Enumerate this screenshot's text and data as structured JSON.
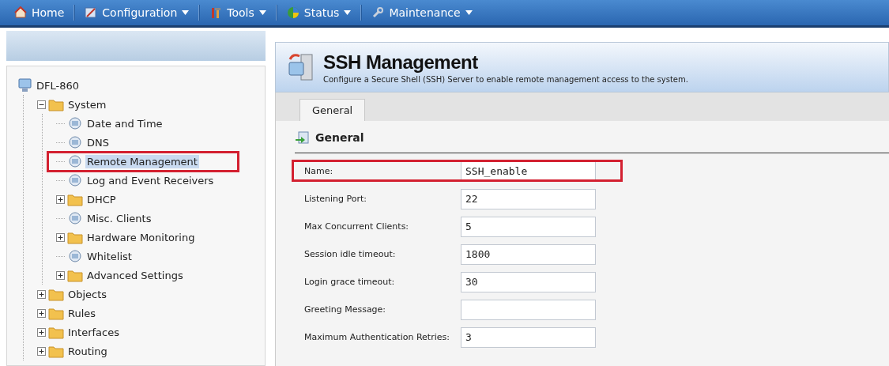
{
  "nav": [
    {
      "label": "Home",
      "dropdown": false
    },
    {
      "label": "Configuration",
      "dropdown": true
    },
    {
      "label": "Tools",
      "dropdown": true
    },
    {
      "label": "Status",
      "dropdown": true
    },
    {
      "label": "Maintenance",
      "dropdown": true
    }
  ],
  "tree": [
    {
      "label": "DFL-860",
      "kind": "root",
      "selected": false,
      "highlighted": false,
      "children": [
        {
          "label": "System",
          "kind": "branch",
          "expanded": true,
          "selected": false,
          "highlighted": false,
          "children": [
            {
              "label": "Date and Time",
              "kind": "leaf",
              "selected": false,
              "highlighted": false
            },
            {
              "label": "DNS",
              "kind": "leaf",
              "selected": false,
              "highlighted": false
            },
            {
              "label": "Remote Management",
              "kind": "leaf",
              "selected": true,
              "highlighted": true
            },
            {
              "label": "Log and Event Receivers",
              "kind": "leaf",
              "selected": false,
              "highlighted": false
            },
            {
              "label": "DHCP",
              "kind": "branch",
              "expanded": false,
              "selected": false,
              "highlighted": false
            },
            {
              "label": "Misc. Clients",
              "kind": "leaf",
              "selected": false,
              "highlighted": false
            },
            {
              "label": "Hardware Monitoring",
              "kind": "branch",
              "expanded": false,
              "selected": false,
              "highlighted": false
            },
            {
              "label": "Whitelist",
              "kind": "leaf",
              "selected": false,
              "highlighted": false
            },
            {
              "label": "Advanced Settings",
              "kind": "branch",
              "expanded": false,
              "selected": false,
              "highlighted": false
            }
          ]
        },
        {
          "label": "Objects",
          "kind": "branch",
          "expanded": false,
          "selected": false,
          "highlighted": false
        },
        {
          "label": "Rules",
          "kind": "branch",
          "expanded": false,
          "selected": false,
          "highlighted": false
        },
        {
          "label": "Interfaces",
          "kind": "branch",
          "expanded": false,
          "selected": false,
          "highlighted": false
        },
        {
          "label": "Routing",
          "kind": "branch",
          "expanded": false,
          "selected": false,
          "highlighted": false
        }
      ]
    }
  ],
  "page": {
    "title": "SSH Management",
    "subtitle": "Configure a Secure Shell (SSH) Server to enable remote management access to the system.",
    "tabs": [
      {
        "label": "General",
        "selected": true
      }
    ],
    "section": "General",
    "fields": [
      {
        "label": "Name:",
        "value": "SSH_enable",
        "highlighted": true
      },
      {
        "label": "Listening Port:",
        "value": "22",
        "highlighted": false
      },
      {
        "label": "Max Concurrent Clients:",
        "value": "5",
        "highlighted": false
      },
      {
        "label": "Session idle timeout:",
        "value": "1800",
        "highlighted": false
      },
      {
        "label": "Login grace timeout:",
        "value": "30",
        "highlighted": false
      },
      {
        "label": "Greeting Message:",
        "highlighted": false
      },
      {
        "label": "Maximum Authentication Retries:",
        "value": "3",
        "highlighted": false
      }
    ]
  }
}
